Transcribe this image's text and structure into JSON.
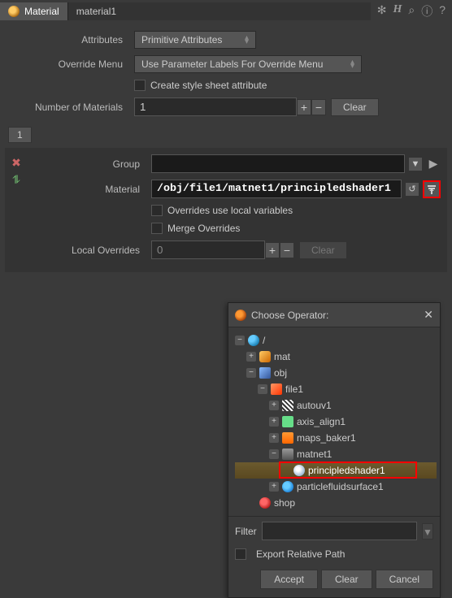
{
  "header": {
    "node_type": "Material",
    "node_name": "material1"
  },
  "header_icons": {
    "gear": "✻",
    "h": "H",
    "search": "⌕",
    "info": "ⓘ",
    "help": "?"
  },
  "params": {
    "attributes_label": "Attributes",
    "attributes_value": "Primitive Attributes",
    "override_menu_label": "Override Menu",
    "override_menu_value": "Use Parameter Labels For Override Menu",
    "create_stylesheet_label": "Create style sheet attribute",
    "num_materials_label": "Number of Materials",
    "num_materials_value": "1",
    "clear_label": "Clear",
    "tab1": "1"
  },
  "group_section": {
    "group_label": "Group",
    "group_value": "",
    "material_label": "Material",
    "material_value": "/obj/file1/matnet1/principledshader1",
    "overrides_local_label": "Overrides use local variables",
    "merge_overrides_label": "Merge Overrides",
    "local_overrides_label": "Local Overrides",
    "local_overrides_value": "0",
    "clear_label": "Clear"
  },
  "popup": {
    "title": "Choose Operator:",
    "tree": {
      "root": "/",
      "items": [
        {
          "name": "mat"
        },
        {
          "name": "obj",
          "children": [
            {
              "name": "file1",
              "children": [
                {
                  "name": "autouv1"
                },
                {
                  "name": "axis_align1"
                },
                {
                  "name": "maps_baker1"
                },
                {
                  "name": "matnet1",
                  "children": [
                    {
                      "name": "principledshader1",
                      "selected": true
                    }
                  ]
                },
                {
                  "name": "particlefluidsurface1"
                }
              ]
            }
          ]
        },
        {
          "name": "shop"
        }
      ]
    },
    "filter_label": "Filter",
    "filter_value": "",
    "export_label": "Export Relative Path",
    "accept_label": "Accept",
    "clear_label": "Clear",
    "cancel_label": "Cancel"
  }
}
